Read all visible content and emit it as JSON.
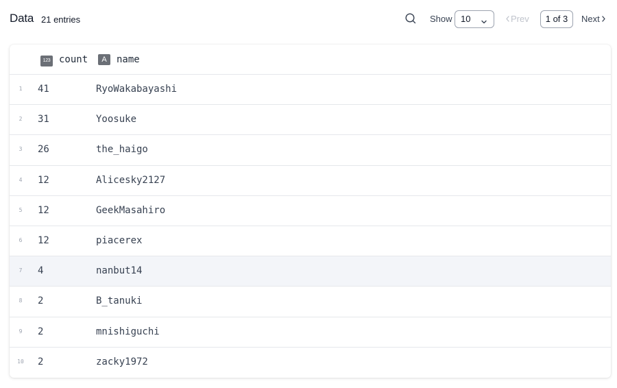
{
  "header": {
    "title": "Data",
    "entries": "21 entries",
    "show_label": "Show",
    "page_size": "10",
    "prev_label": "Prev",
    "page_indicator": "1 of 3",
    "next_label": "Next"
  },
  "table": {
    "columns": [
      {
        "type_badge": "123",
        "label": "count"
      },
      {
        "type_badge": "A",
        "label": "name"
      }
    ],
    "rows": [
      {
        "index": "1",
        "count": "41",
        "name": "RyoWakabayashi"
      },
      {
        "index": "2",
        "count": "31",
        "name": "Yoosuke"
      },
      {
        "index": "3",
        "count": "26",
        "name": "the_haigo"
      },
      {
        "index": "4",
        "count": "12",
        "name": "Alicesky2127"
      },
      {
        "index": "5",
        "count": "12",
        "name": "GeekMasahiro"
      },
      {
        "index": "6",
        "count": "12",
        "name": "piacerex"
      },
      {
        "index": "7",
        "count": "4",
        "name": "nanbut14"
      },
      {
        "index": "8",
        "count": "2",
        "name": "B_tanuki"
      },
      {
        "index": "9",
        "count": "2",
        "name": "mnishiguchi"
      },
      {
        "index": "10",
        "count": "2",
        "name": "zacky1972"
      }
    ],
    "hovered_row": "7"
  },
  "colors": {
    "hover_row": "#f3f5f9",
    "badge": "#6b6f76",
    "disabled_text": "#c0c4cc"
  },
  "icons": [
    "search-icon",
    "chevron-down-icon",
    "chevron-left-icon",
    "chevron-right-icon"
  ]
}
